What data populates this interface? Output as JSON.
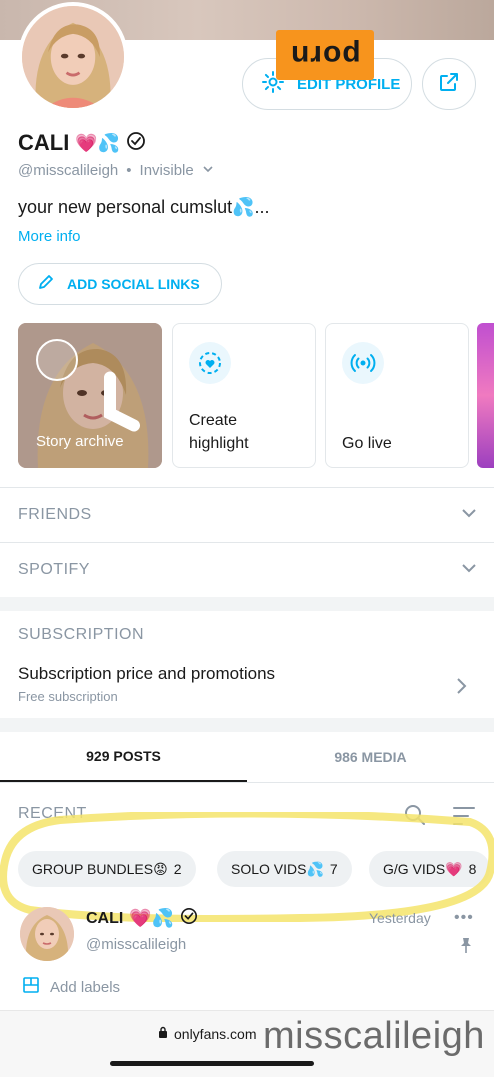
{
  "watermark": {
    "site": "porn"
  },
  "profile": {
    "name": "CALI",
    "name_emojis": "💗💦",
    "handle": "@misscalileigh",
    "status": "Invisible",
    "bio": "your new personal cumslut💦...",
    "more_info": "More info"
  },
  "buttons": {
    "edit_profile": "EDIT PROFILE",
    "add_social_links": "ADD SOCIAL LINKS"
  },
  "highlights": {
    "archive": "Story archive",
    "create_line1": "Create",
    "create_line2": "highlight",
    "live": "Go live"
  },
  "sections": {
    "friends": "FRIENDS",
    "spotify": "SPOTIFY",
    "subscription": "SUBSCRIPTION",
    "subscription_main": "Subscription price and promotions",
    "subscription_sub": "Free subscription"
  },
  "tabs": {
    "posts": "929 POSTS",
    "media": "986 MEDIA"
  },
  "recent": {
    "label": "RECENT",
    "chips": [
      {
        "label": "GROUP BUNDLES😡",
        "count": "2"
      },
      {
        "label": "SOLO VIDS💦",
        "count": "7"
      },
      {
        "label": "G/G VIDS💗",
        "count": "8"
      }
    ]
  },
  "post": {
    "name": "CALI",
    "name_emojis": "💗💦",
    "handle": "@misscalileigh",
    "time": "Yesterday",
    "labels": "Add labels"
  },
  "browser": {
    "url": "onlyfans.com"
  },
  "brand_watermark": "misscalileigh",
  "colors": {
    "accent": "#00aff0",
    "muted": "#8a96a3",
    "watermark_bg": "#f7941d",
    "highlight_marker": "#f5e46b"
  }
}
